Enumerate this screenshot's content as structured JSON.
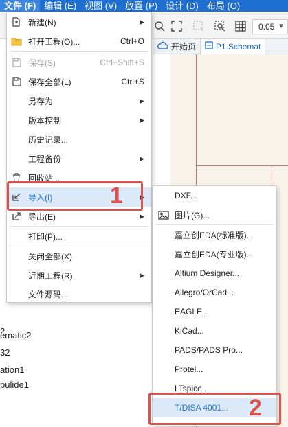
{
  "menubar": {
    "items": [
      {
        "label": "文件 (F)"
      },
      {
        "label": "编辑 (E)"
      },
      {
        "label": "视图 (V)"
      },
      {
        "label": "放置 (P)"
      },
      {
        "label": "设计 (D)"
      },
      {
        "label": "布局 (O)"
      }
    ]
  },
  "toolbar": {
    "zoom_value": "0.05"
  },
  "tabs": {
    "start": "开始页",
    "schematic": "P1.Schemat"
  },
  "left_panel": {
    "lines": [
      "ematic2",
      "32",
      "ation1",
      "pulide1",
      "2"
    ]
  },
  "file_menu": {
    "items": [
      {
        "label": "新建(N)",
        "shortcut": "",
        "icon": "new-file-icon"
      },
      {
        "label": "打开工程(O)...",
        "shortcut": "Ctrl+O",
        "icon": "folder-icon"
      },
      {
        "label": "保存(S)",
        "shortcut": "Ctrl+Shift+S",
        "icon": "save-icon"
      },
      {
        "label": "保存全部(L)",
        "shortcut": "Ctrl+S",
        "icon": "save-all-icon"
      },
      {
        "label": "另存为",
        "shortcut": "",
        "icon": ""
      },
      {
        "label": "版本控制",
        "shortcut": "",
        "icon": ""
      },
      {
        "label": "历史记录...",
        "shortcut": "",
        "icon": ""
      },
      {
        "label": "工程备份",
        "shortcut": "",
        "icon": ""
      },
      {
        "label": "回收站...",
        "shortcut": "",
        "icon": "trash-icon"
      },
      {
        "label": "导入(I)",
        "shortcut": "",
        "icon": "import-icon"
      },
      {
        "label": "导出(E)",
        "shortcut": "",
        "icon": "export-icon"
      },
      {
        "label": "打印(P)...",
        "shortcut": "",
        "icon": ""
      },
      {
        "label": "关闭全部(X)",
        "shortcut": "",
        "icon": ""
      },
      {
        "label": "近期工程(R)",
        "shortcut": "",
        "icon": ""
      },
      {
        "label": "文件源码...",
        "shortcut": "",
        "icon": ""
      }
    ]
  },
  "import_submenu": {
    "items": [
      {
        "label": "DXF..."
      },
      {
        "label": "图片(G)..."
      },
      {
        "label": "嘉立创EDA(标准版)..."
      },
      {
        "label": "嘉立创EDA(专业版)..."
      },
      {
        "label": "Altium Designer..."
      },
      {
        "label": "Allegro/OrCad..."
      },
      {
        "label": "EAGLE..."
      },
      {
        "label": "KiCad..."
      },
      {
        "label": "PADS/PADS Pro..."
      },
      {
        "label": "Protel..."
      },
      {
        "label": "LTspice..."
      },
      {
        "label": "T/DISA 4001..."
      }
    ]
  },
  "annotations": {
    "step1": "1",
    "step2": "2"
  },
  "colors": {
    "menubar": "#1e6fd0",
    "highlight": "#dbe9f8",
    "annotation": "#d9534f"
  }
}
